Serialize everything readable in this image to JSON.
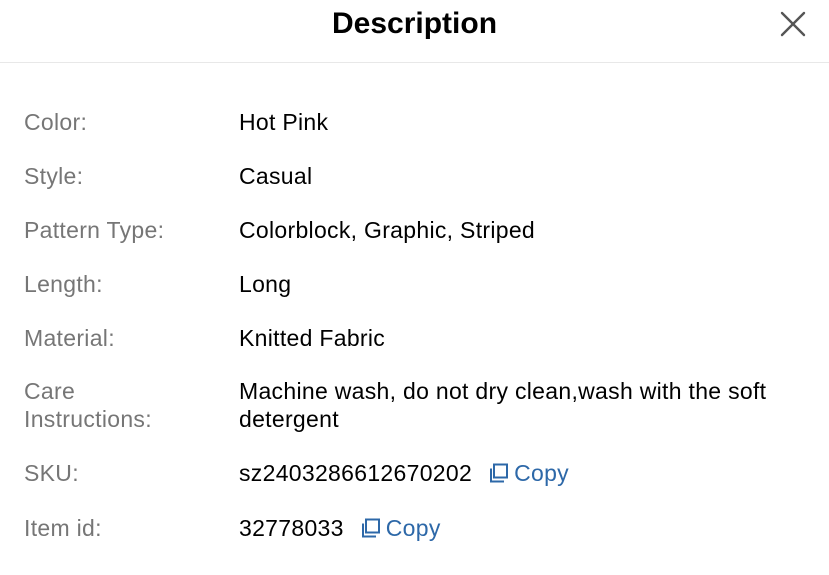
{
  "header": {
    "title": "Description"
  },
  "rows": [
    {
      "label": "Color:",
      "value": "Hot Pink"
    },
    {
      "label": "Style:",
      "value": "Casual"
    },
    {
      "label": "Pattern Type:",
      "value": "Colorblock, Graphic, Striped"
    },
    {
      "label": "Length:",
      "value": "Long"
    },
    {
      "label": "Material:",
      "value": "Knitted Fabric"
    },
    {
      "label": "Care\nInstructions:",
      "value": "Machine wash, do not dry clean,wash with the soft detergent"
    },
    {
      "label": "SKU:",
      "value": "sz2403286612670202",
      "copy_label": "Copy"
    },
    {
      "label": "Item id:",
      "value": "32778033",
      "copy_label": "Copy"
    }
  ],
  "colors": {
    "label": "#767676",
    "value": "#000000",
    "link": "#2d68a8",
    "divider": "#e8e8e8"
  },
  "icons": {
    "close": "close-icon",
    "copy": "copy-icon"
  }
}
